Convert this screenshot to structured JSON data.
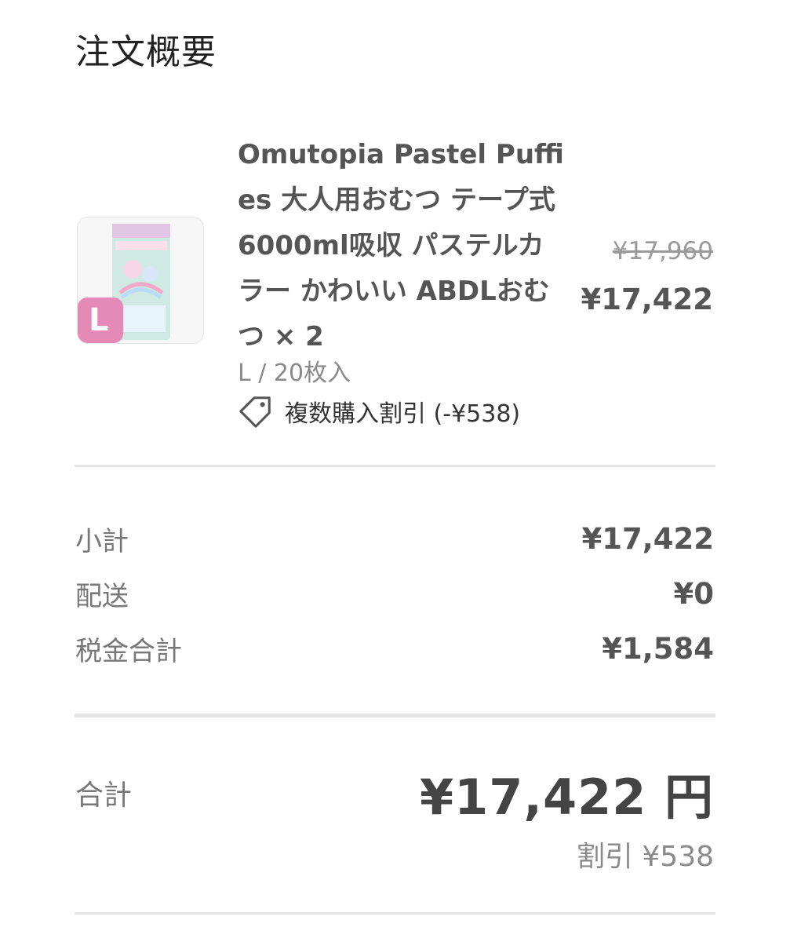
{
  "page_title": "注文概要",
  "product": {
    "title": "Omutopia Pastel Puffies 大人用おむつ テープ式 6000ml吸収 パステルカラー かわいい ABDLおむつ × 2",
    "variant": "L / 20枚入",
    "discount_label": "複数購入割引 (-¥538)",
    "original_price": "¥17,960",
    "final_price": "¥17,422",
    "image_badge": "L",
    "tag_icon": "tag-icon"
  },
  "summary": {
    "subtotal_label": "小計",
    "subtotal_value": "¥17,422",
    "shipping_label": "配送",
    "shipping_value": "¥0",
    "tax_label": "税金合計",
    "tax_value": "¥1,584"
  },
  "total": {
    "label": "合計",
    "value": "¥17,422 円",
    "discount": "割引 ¥538"
  },
  "colors": {
    "badge": "#e58ab6",
    "divider": "#e6e6e6"
  }
}
